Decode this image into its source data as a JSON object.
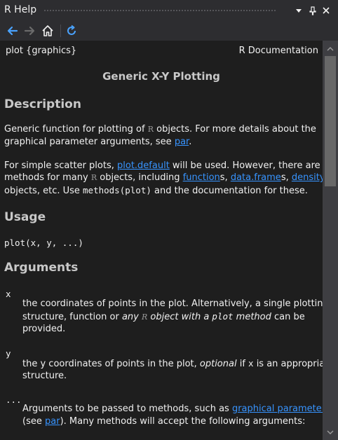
{
  "window": {
    "title": "R Help"
  },
  "toolbar": {
    "back": "back-arrow-icon",
    "forward": "forward-arrow-icon",
    "home": "home-icon",
    "refresh": "refresh-icon"
  },
  "doc": {
    "header_left": "plot {graphics}",
    "header_right": "R Documentation",
    "title": "Generic X-Y Plotting",
    "description_heading": "Description",
    "desc1": {
      "line1_a": "Generic function for plotting of ",
      "r_logo": "R",
      "line1_b": " objects. For more details about the",
      "line2_a": "graphical parameter arguments, see ",
      "link_par": "par",
      "line2_b": "."
    },
    "desc2": {
      "line1_a": "For simple scatter plots, ",
      "link_plot_default": "plot.default",
      "line1_b": " will be used. However, there are ",
      "code_plot": "plot",
      "line2_a": "methods for many ",
      "r_logo": "R",
      "line2_b": " objects, including ",
      "link_functions": "function",
      "line2_c": "s, ",
      "link_dataframe": "data.frame",
      "line2_d": "s, ",
      "link_density": "density",
      "line3_a": "objects, etc. Use ",
      "code_methods": "methods(plot)",
      "line3_b": " and the documentation for these."
    },
    "usage_heading": "Usage",
    "usage_code": "plot(x, y, ...)",
    "arguments_heading": "Arguments",
    "arg_x": {
      "name": "x",
      "line1": "the coordinates of points in the plot. Alternatively, a single plotting",
      "line2_a": "structure, function or ",
      "line2_any": "any",
      "r_logo": "R",
      "line2_b": " object with a ",
      "line2_plot": "plot",
      "line2_c": " method",
      "line2_d": " can be",
      "line3": "provided."
    },
    "arg_y": {
      "name": "y",
      "line1_a": "the y coordinates of points in the plot, ",
      "line1_opt": "optional",
      "line1_b": " if ",
      "line1_x": "x",
      "line1_c": " is an appropriate",
      "line2": "structure."
    },
    "arg_dots": {
      "name": "...",
      "line1_a": "Arguments to be passed to methods, such as ",
      "link_gp": "graphical parameters",
      "line2_a": "(see ",
      "link_par": "par",
      "line2_b": "). Many methods will accept the following arguments:"
    }
  }
}
